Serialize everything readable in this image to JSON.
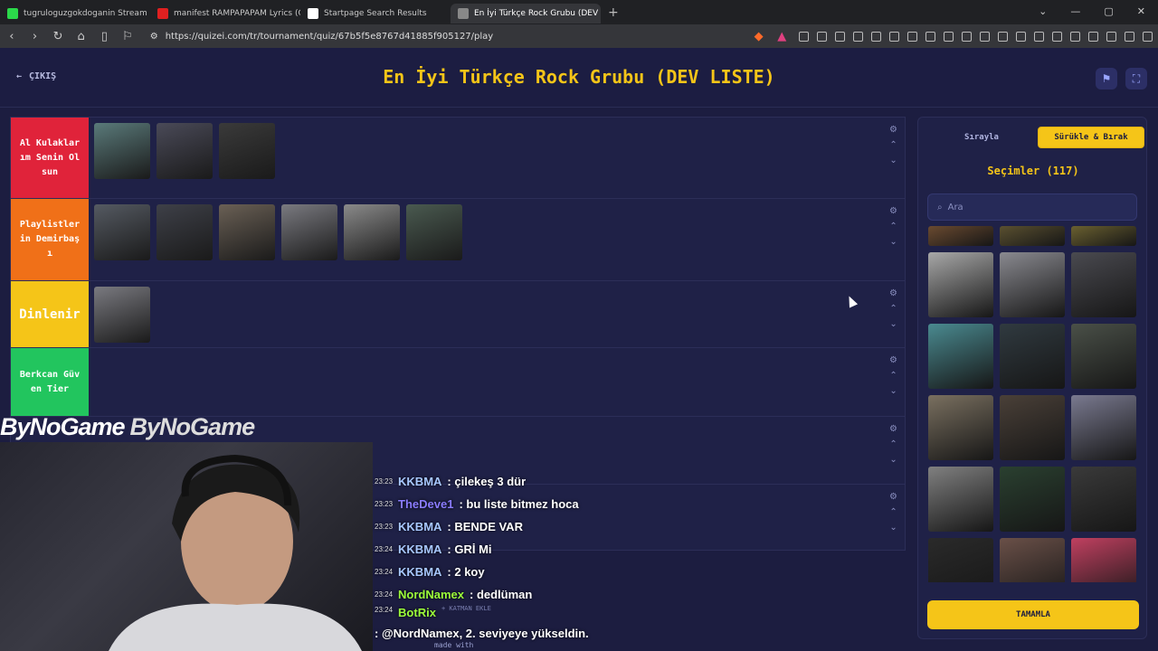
{
  "browser": {
    "tabs": [
      {
        "label": "tugruloguzgokdoganin Stream - Wat",
        "color": "#2bd94a"
      },
      {
        "label": "manifest RAMPAPAPAM Lyrics (Color",
        "color": "#e02020"
      },
      {
        "label": "Startpage Search Results",
        "color": "#ffffff"
      },
      {
        "label": "En İyi Türkçe Rock Grubu (DEV LİSTE)",
        "color": "#888888"
      }
    ],
    "url": "https://quizei.com/tr/tournament/quiz/67b5f5e8767d41885f905127/play"
  },
  "header": {
    "exit_label": "ÇIKIŞ",
    "title": "En İyi Türkçe Rock Grubu (DEV LISTE)"
  },
  "tiers": [
    {
      "label": "Al Kulaklarım Senin Olsun",
      "color": "#e0233a",
      "items": 3,
      "height": 90
    },
    {
      "label": "Playlistlerin Demirbaşı",
      "color": "#f07018",
      "items": 6,
      "height": 91
    },
    {
      "label": "Dinlenir",
      "color": "#f5c518",
      "items": 1,
      "height": 74
    },
    {
      "label": "Berkcan Güven Tier",
      "color": "#22c55e",
      "items": 0,
      "height": 76
    },
    {
      "label": "",
      "color": "#1f2147",
      "items": 0,
      "height": 75
    },
    {
      "label": "",
      "color": "#1f2147",
      "items": 0,
      "height": 74
    }
  ],
  "panel": {
    "mode_ordered": "Sırayla",
    "mode_drag": "Sürükle & Bırak",
    "selections_label": "Seçimler (117)",
    "search_placeholder": "Ara",
    "done_label": "TAMAMLA"
  },
  "add_column_label": "+ KATMAN EKLE",
  "made_with_label": "made with",
  "brand_label": "ByNoGame",
  "brand_label_2": "ByNoGame",
  "chat": [
    {
      "time": "23:23",
      "user": "KKBMA",
      "color": "#a8c8ff",
      "text": ": çilekeş 3 dür"
    },
    {
      "time": "23:23",
      "user": "TheDeve1",
      "color": "#8a7cff",
      "text": ": bu liste bitmez hoca"
    },
    {
      "time": "23:23",
      "user": "KKBMA",
      "color": "#a8c8ff",
      "text": ": BENDE VAR"
    },
    {
      "time": "23:24",
      "user": "KKBMA",
      "color": "#a8c8ff",
      "text": ": GRİ Mi"
    },
    {
      "time": "23:24",
      "user": "KKBMA",
      "color": "#a8c8ff",
      "text": ": 2 koy"
    },
    {
      "time": "23:24",
      "user": "NordNamex",
      "color": "#9cff3a",
      "text": ": dedlüman"
    },
    {
      "time": "23:24",
      "user": "BotRix",
      "color": "#9cff3a",
      "text": ": @NordNamex, 2. seviyeye yükseldin."
    }
  ]
}
